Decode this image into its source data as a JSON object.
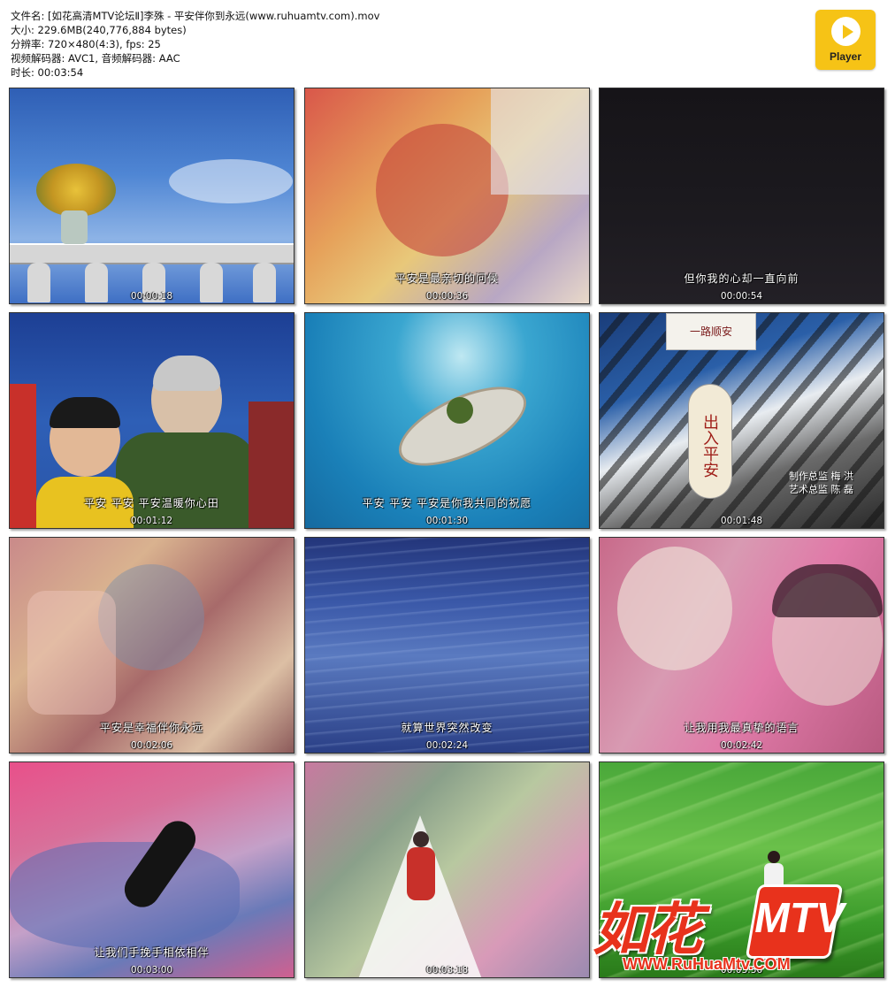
{
  "file_info": {
    "filename": "文件名: [如花高清MTV论坛Ⅱ]李殊 - 平安伴你到永远(www.ruhuamtv.com).mov",
    "size": "大小: 229.6MB(240,776,884 bytes)",
    "resolution": "分辨率: 720×480(4:3), fps: 25",
    "codecs": "视频解码器: AVC1, 音频解码器: AAC",
    "duration": "时长: 00:03:54"
  },
  "player_logo": {
    "label": "Player",
    "icon": "play-circle-icon",
    "color": "#f6c316"
  },
  "thumbnails": [
    {
      "timestamp": "00:00:18",
      "subtitle": ""
    },
    {
      "timestamp": "00:00:36",
      "subtitle": "平安是最亲切的问候"
    },
    {
      "timestamp": "00:00:54",
      "subtitle": "但你我的心却一直向前"
    },
    {
      "timestamp": "00:01:12",
      "subtitle": "平安   平安   平安温暖你心田"
    },
    {
      "timestamp": "00:01:30",
      "subtitle": "平安   平安   平安是你我共同的祝愿"
    },
    {
      "timestamp": "00:01:48",
      "subtitle": "",
      "credits": [
        "制作总监  梅  洪",
        "艺术总监  陈  磊"
      ],
      "sign": "出入平安",
      "sign_top": "一路顺安"
    },
    {
      "timestamp": "00:02:06",
      "subtitle": "平安是幸福伴你永远"
    },
    {
      "timestamp": "00:02:24",
      "subtitle": "就算世界突然改变"
    },
    {
      "timestamp": "00:02:42",
      "subtitle": "让我用我最真挚的语言"
    },
    {
      "timestamp": "00:03:00",
      "subtitle": "让我们手挽手相依相伴"
    },
    {
      "timestamp": "00:03:18",
      "subtitle": ""
    },
    {
      "timestamp": "00:03:36",
      "subtitle": ""
    }
  ],
  "watermark": {
    "brand": "如花",
    "mtv": "MTV",
    "url": "WWW.RuHuaMtv.COM"
  }
}
